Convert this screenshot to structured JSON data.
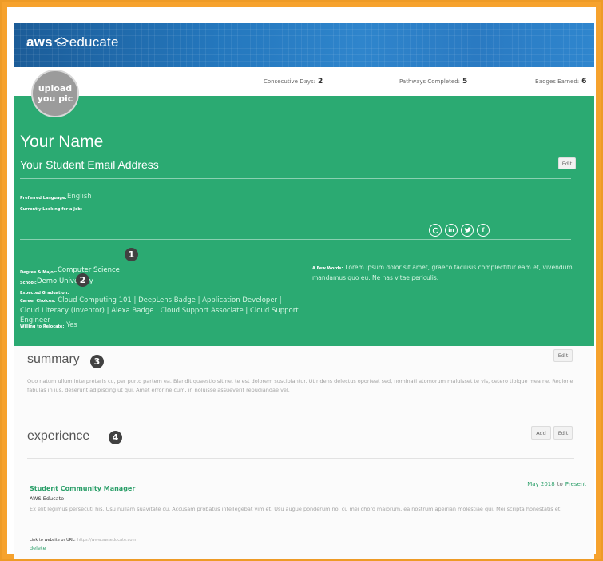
{
  "header": {
    "logo_aws": "aws",
    "logo_educate": "educate"
  },
  "avatar": {
    "label_line1": "upload",
    "label_line2": "you pic"
  },
  "stats": {
    "consecutive_label": "Consecutive Days:",
    "consecutive_value": "2",
    "pathways_label": "Pathways Completed:",
    "pathways_value": "5",
    "badges_label": "Badges Earned:",
    "badges_value": "6"
  },
  "profile": {
    "name": "Your Name",
    "email": "Your Student Email Address",
    "edit_label": "Edit",
    "preferred_language_label": "Preferred Language:",
    "preferred_language_value": "English",
    "looking_for_job_label": "Currently Looking for a Job:",
    "socials": [
      "github-icon",
      "linkedin-icon",
      "twitter-icon",
      "facebook-icon"
    ],
    "degree_label": "Degree & Major:",
    "degree_value": "Computer Science",
    "school_label": "School:",
    "school_value": "Demo University",
    "graduation_label": "Expected Graduation:",
    "career_label": "Career Choices:",
    "career_value": "Cloud Computing 101 | DeepLens Badge | Application Developer | Cloud Literacy (Inventor) | Alexa Badge | Cloud Support Associate | Cloud Support Engineer",
    "relocate_label": "Willing to Relocate:",
    "relocate_value": "Yes",
    "few_words_label": "A Few Words:",
    "few_words_value": "Lorem ipsum dolor sit amet, graeco facilisis complectitur eam et, vivendum mandamus quo eu. Ne has vitae periculis."
  },
  "markers": [
    "1",
    "2",
    "3",
    "4"
  ],
  "summary": {
    "title": "summary",
    "edit_label": "Edit",
    "text": "Quo natum ullum interpretaris cu, per purto partem ea. Blandit quaestio sit ne, te est dolorem suscipiantur. Ut ridens delectus oporteat sed, nominati atomorum maluisset te vis, cetero tibique mea ne. Regione fabulas in ius, deserunt adipiscing ut qui. Amet error ne cum, in noluisse assueverit repudiandae vel."
  },
  "experience": {
    "title": "experience",
    "add_label": "Add",
    "edit_label": "Edit",
    "job_title": "Student Community Manager",
    "company": "AWS Educate",
    "date_start": "May 2018",
    "date_sep": "to",
    "date_end": "Present",
    "description": "Ex elit legimus persecuti his. Usu nullam suavitate cu. Accusam probatus intellegebat vim et. Usu augue ponderum no, cu mei choro maiorum, ea nostrum apeirian molestiae qui. Mei scripta honestatis et.",
    "link_label": "Link to website or URL:",
    "link_value": "https://www.awseducate.com",
    "delete_label": "delete"
  },
  "colors": {
    "frame_orange": "#f6a22d",
    "aws_blue": "#1f67a8",
    "profile_green": "#2baa72",
    "marker_dark": "#414141"
  }
}
